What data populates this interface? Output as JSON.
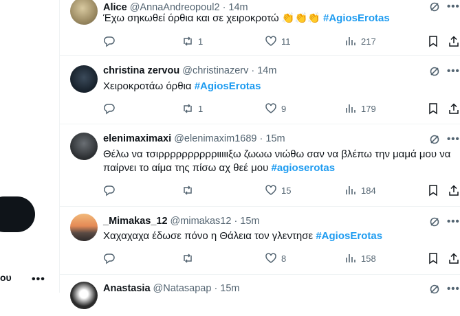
{
  "left": {
    "account_name": "ου",
    "more": "•••"
  },
  "tweets": [
    {
      "name": "Alice",
      "handle": "@AnnaAndreopoul2",
      "time": "· 14m",
      "text": "Έχω σηκωθεί όρθια και σε χειροκροτώ ",
      "emoji": "👏👏👏",
      "tag": "#AgiosErotas",
      "replies": "",
      "reposts": "1",
      "likes": "11",
      "views": "217"
    },
    {
      "name": "christina zervou",
      "handle": "@christinazerv",
      "time": "· 14m",
      "text": "Χειροκροτάω όρθια ",
      "tag": "#AgiosErotas",
      "replies": "",
      "reposts": "1",
      "likes": "9",
      "views": "179"
    },
    {
      "name": "elenimaximaxi",
      "handle": "@elenimaxim1689",
      "time": "· 15m",
      "text": "Θέλω να τσιρρρρρρρρρριιιιιξω ζωωω νιώθω σαν να βλέπω την μαμά μου να παίρνει το αίμα της πίσω αχ θεέ μου ",
      "tag": "#agioserotas",
      "replies": "",
      "reposts": "",
      "likes": "15",
      "views": "184"
    },
    {
      "name": "_Mimakas_12",
      "handle": "@mimakas12",
      "time": "· 15m",
      "text": "Χαχαχαχα έδωσε πόνο η Θάλεια τον γλεντησε ",
      "tag": "#AgiosErotas",
      "replies": "",
      "reposts": "",
      "likes": "8",
      "views": "158"
    },
    {
      "name": "Anastasia",
      "handle": "@Natasapap",
      "time": "· 15m"
    }
  ],
  "colors": {
    "accent": "#1d9bf0",
    "text": "#0f1419",
    "muted": "#536471",
    "border": "#eff3f4"
  }
}
